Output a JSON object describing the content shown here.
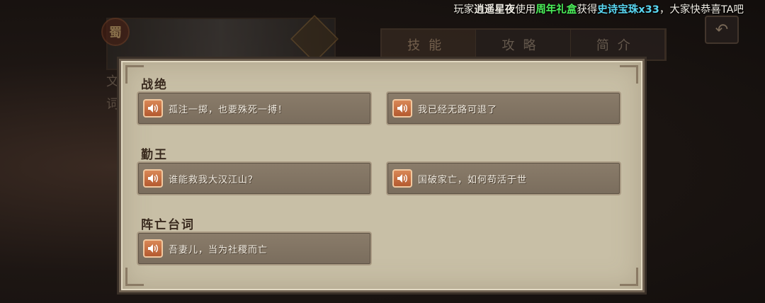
{
  "banner": {
    "prefix": "玩家",
    "player": "逍遥星夜",
    "used": "使用",
    "item": "周年礼盒",
    "got": "获得",
    "reward": "史诗宝珠x33",
    "suffix": "，大家快恭喜TA吧"
  },
  "background": {
    "tabs": [
      "技能",
      "攻略",
      "简介"
    ],
    "seal_char": "蜀",
    "left_chars": [
      "文",
      "词"
    ],
    "back_icon": "back-arrow-icon"
  },
  "dialog": {
    "sections": [
      {
        "title": "战绝",
        "lines": [
          "孤注一掷，也要殊死一搏！",
          "我已经无路可退了"
        ]
      },
      {
        "title": "勤王",
        "lines": [
          "谁能救我大汉江山？",
          "国破家亡，如何苟活于世"
        ]
      },
      {
        "title": "阵亡台词",
        "lines": [
          "吾妻儿，当为社稷而亡"
        ]
      }
    ],
    "icon": "speaker-icon",
    "colors": {
      "panel": "#c8bfa6",
      "button": "#7f7262",
      "speaker": "#c86e40"
    }
  }
}
